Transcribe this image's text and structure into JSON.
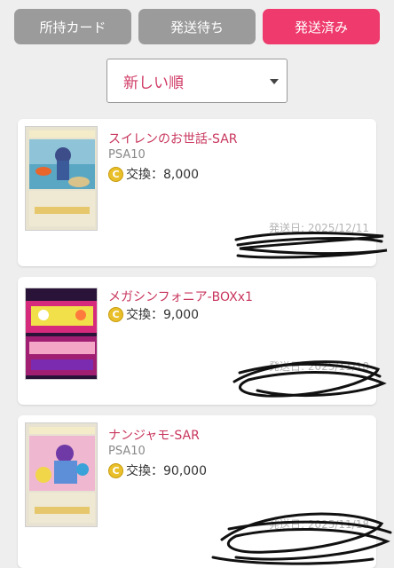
{
  "tabs": [
    {
      "label": "所持カード"
    },
    {
      "label": "発送待ち"
    },
    {
      "label": "発送済み"
    }
  ],
  "sort": {
    "selected": "新しい順"
  },
  "items": [
    {
      "title": "スイレンのお世話-SAR",
      "grade": "PSA10",
      "coin": "C",
      "price": "交換：8,000",
      "ship_date": "発送日: 2025/12/11"
    },
    {
      "title": "メガシンフォニア-BOXx1",
      "grade": "",
      "coin": "C",
      "price": "交換：9,000",
      "ship_date": "発送日: 2025/11/18"
    },
    {
      "title": "ナンジャモ-SAR",
      "grade": "PSA10",
      "coin": "C",
      "price": "交換：90,000",
      "ship_date": "発送日: 2025/11/18"
    }
  ],
  "colors": {
    "accent": "#ee3a6c",
    "tab_inactive": "#9b9b9b",
    "title": "#c8365d",
    "coin": "#e9bf2a"
  }
}
